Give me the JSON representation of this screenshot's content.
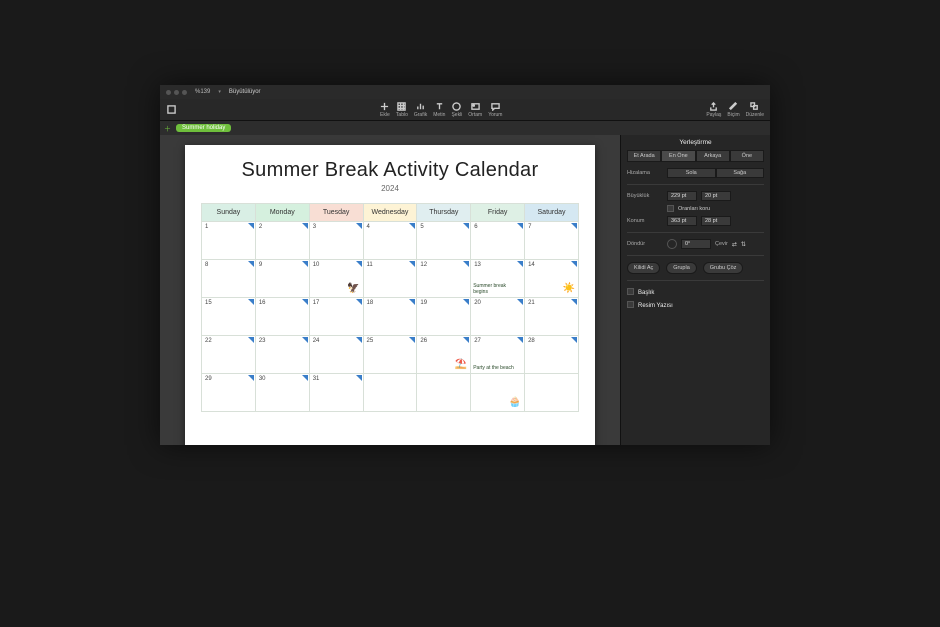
{
  "menubar": {
    "zoom": "%139",
    "doc_title": "Büyütülüyor"
  },
  "toolbar": {
    "items": [
      {
        "label": "Ekle",
        "icon": "table"
      },
      {
        "label": "Tablo",
        "icon": "table"
      },
      {
        "label": "Grafik",
        "icon": "chart"
      },
      {
        "label": "Metin",
        "icon": "text"
      },
      {
        "label": "Şekli",
        "icon": "shape"
      },
      {
        "label": "Ortam",
        "icon": "media"
      },
      {
        "label": "Yorum",
        "icon": "comment"
      }
    ],
    "right": [
      {
        "label": "Paylaş",
        "icon": "share"
      },
      {
        "label": "Biçim",
        "icon": "format"
      },
      {
        "label": "Düzenle",
        "icon": "organize"
      }
    ]
  },
  "tabbar": {
    "active_tab": "Summer holiday"
  },
  "page": {
    "title": "Summer Break Activity Calendar",
    "year": "2024",
    "days": [
      "Sunday",
      "Monday",
      "Tuesday",
      "Wednesday",
      "Thursday",
      "Friday",
      "Saturday"
    ],
    "rows": [
      [
        {
          "n": "1"
        },
        {
          "n": "2"
        },
        {
          "n": "3"
        },
        {
          "n": "4"
        },
        {
          "n": "5"
        },
        {
          "n": "6"
        },
        {
          "n": "7"
        }
      ],
      [
        {
          "n": "8"
        },
        {
          "n": "9"
        },
        {
          "n": "10",
          "icon": "🦅"
        },
        {
          "n": "11"
        },
        {
          "n": "12"
        },
        {
          "n": "13",
          "event": "Summer break begins"
        },
        {
          "n": "14",
          "icon": "☀️"
        }
      ],
      [
        {
          "n": "15"
        },
        {
          "n": "16"
        },
        {
          "n": "17"
        },
        {
          "n": "18"
        },
        {
          "n": "19"
        },
        {
          "n": "20"
        },
        {
          "n": "21"
        }
      ],
      [
        {
          "n": "22"
        },
        {
          "n": "23"
        },
        {
          "n": "24"
        },
        {
          "n": "25"
        },
        {
          "n": "26",
          "icon": "⛱️"
        },
        {
          "n": "27",
          "event": "Party at the beach"
        },
        {
          "n": "28"
        }
      ],
      [
        {
          "n": "29"
        },
        {
          "n": "30"
        },
        {
          "n": "31"
        },
        {
          "n": ""
        },
        {
          "n": ""
        },
        {
          "n": "",
          "icon": "🧁"
        },
        {
          "n": ""
        }
      ]
    ]
  },
  "inspector": {
    "mode_label": "Yerleştirme",
    "tabs": [
      "Et Arada",
      "En Öne",
      "Arkaya",
      "Öne"
    ],
    "alignment": {
      "label": "Hizalama",
      "options": [
        "Sola",
        "Sağa"
      ]
    },
    "size": {
      "label": "Büyüklük",
      "w": "229 pt",
      "h": "20 pt",
      "lock": "Oranları koru"
    },
    "position": {
      "label": "Konum",
      "x": "363 pt",
      "y": "28 pt"
    },
    "rotation": {
      "label": "Döndür",
      "value": "0°"
    },
    "flip": {
      "label": "Çevir"
    },
    "actions": {
      "lock": "Kilidi Aç",
      "group": "Grupla",
      "ungroup": "Grubu Çöz"
    },
    "title_check": {
      "label": "Başlık",
      "checked": false
    },
    "caption_check": {
      "label": "Resim Yazısı",
      "checked": false
    }
  }
}
